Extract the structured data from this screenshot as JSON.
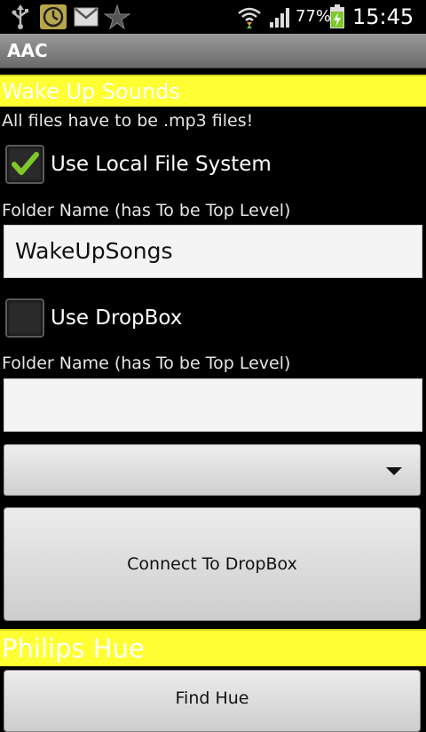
{
  "status_bar": {
    "battery_percent": "77%",
    "time": "15:45",
    "icons": [
      "usb-icon",
      "alarm-clock-icon",
      "gmail-icon",
      "star-shape-icon",
      "wifi-icon",
      "signal-icon",
      "battery-charging-icon"
    ]
  },
  "app_title": "AAC",
  "wake_up": {
    "heading": "Wake Up Sounds",
    "note": "All files have to be .mp3 files!",
    "local": {
      "label": "Use Local File System",
      "checked": true,
      "folder_label": "Folder Name (has To be Top Level)",
      "folder_value": "WakeUpSongs"
    },
    "dropbox": {
      "label": "Use DropBox",
      "checked": false,
      "folder_label": "Folder Name (has To be Top Level)",
      "folder_value": "",
      "spinner_value": "",
      "connect_label": "Connect To DropBox"
    }
  },
  "hue": {
    "heading": "Philips Hue",
    "find_label": "Find Hue"
  },
  "colors": {
    "section_heading_bg": "#ffff33",
    "background": "#000000",
    "check_green": "#7ec82a"
  }
}
